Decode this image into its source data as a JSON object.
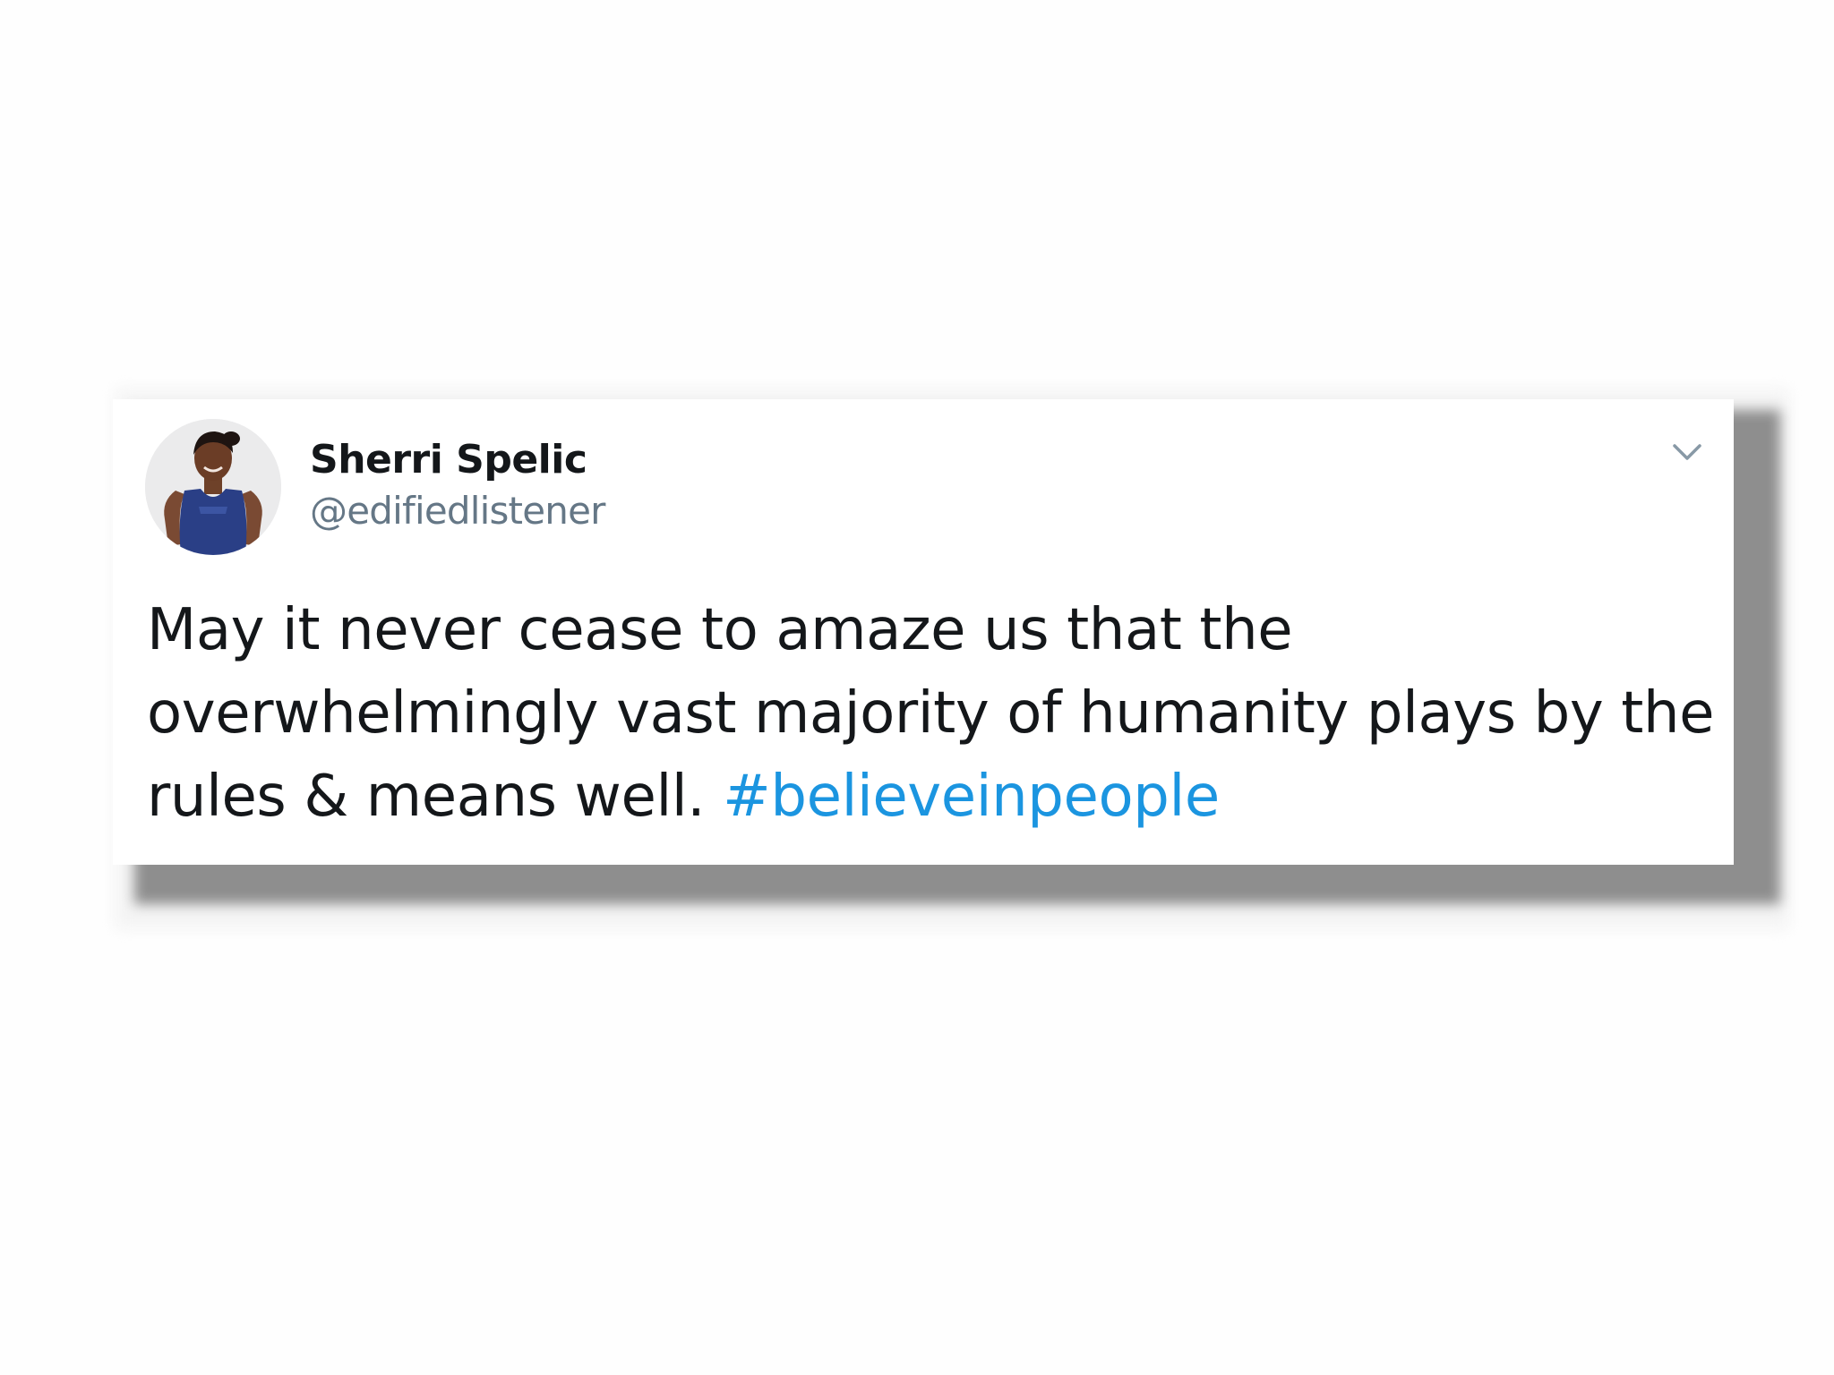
{
  "tweet": {
    "display_name": "Sherri Spelic",
    "handle": "@edifiedlistener",
    "text_lines": [
      "May it never cease to amaze us that the",
      "overwhelmingly vast majority of humanity plays by the",
      "rules & means well. "
    ],
    "hashtag": "#believeinpeople",
    "avatar_icon": "profile-photo",
    "menu_icon": "chevron-down-icon",
    "colors": {
      "hashtag": "#1b95e0",
      "text": "#14171a",
      "handle": "#657786"
    }
  }
}
